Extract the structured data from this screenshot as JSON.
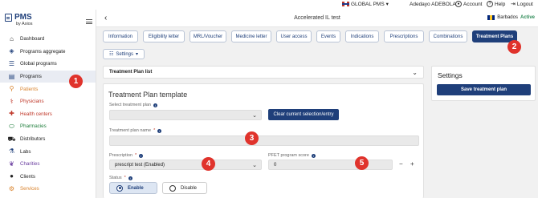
{
  "topbar": {
    "language": "GLOBAL PMS",
    "user": "Adedayo ADEBOLA",
    "account": "Account",
    "help": "Help",
    "logout": "Logout"
  },
  "logo": {
    "title": "PMS",
    "subtitle": "by Axios"
  },
  "sidebar": {
    "items": [
      {
        "label": "Dashboard",
        "icon": "home-icon",
        "glyph": "⌂"
      },
      {
        "label": "Programs aggregate",
        "icon": "layers-icon",
        "glyph": "◈"
      },
      {
        "label": "Global programs",
        "icon": "list-icon",
        "glyph": "☰"
      },
      {
        "label": "Programs",
        "icon": "clipboard-icon",
        "glyph": "▤"
      },
      {
        "label": "Patients",
        "icon": "person-icon",
        "glyph": "⚲"
      },
      {
        "label": "Physicians",
        "icon": "doctor-icon",
        "glyph": "⚕"
      },
      {
        "label": "Health centers",
        "icon": "hospital-icon",
        "glyph": "✚"
      },
      {
        "label": "Pharmacies",
        "icon": "pill-icon",
        "glyph": "⬭"
      },
      {
        "label": "Distributors",
        "icon": "truck-icon",
        "glyph": "⛟"
      },
      {
        "label": "Labs",
        "icon": "flask-icon",
        "glyph": "⚗"
      },
      {
        "label": "Charities",
        "icon": "charity-icon",
        "glyph": "❦"
      },
      {
        "label": "Clients",
        "icon": "client-icon",
        "glyph": "●"
      },
      {
        "label": "Services",
        "icon": "services-icon",
        "glyph": "⚙"
      }
    ]
  },
  "header": {
    "title": "Accelerated IL test",
    "country": "Barbados",
    "status": "Active"
  },
  "tabs": [
    {
      "label": "Information"
    },
    {
      "label": "Eligibility letter"
    },
    {
      "label": "MRL/Voucher"
    },
    {
      "label": "Medicine letter"
    },
    {
      "label": "User access"
    },
    {
      "label": "Events"
    },
    {
      "label": "Indications"
    },
    {
      "label": "Prescriptions"
    },
    {
      "label": "Combinations"
    },
    {
      "label": "Treatment Plans"
    }
  ],
  "settings_menu": {
    "label": "Settings"
  },
  "treatment_plan_list": {
    "label": "Treatment Plan list"
  },
  "template": {
    "title": "Treatment Plan template",
    "select_plan_label": "Select treatment plan",
    "select_plan_value": "",
    "clear_button": "Clear current selection/entry",
    "plan_name_label": "Treatment plan name",
    "plan_name_value": "",
    "prescription_label": "Prescription",
    "prescription_value": "prescript test (Enabled)",
    "pfet_label": "PFET program score",
    "pfet_value": "0",
    "status_label": "Status",
    "status_enable": "Enable",
    "status_disable": "Disable"
  },
  "side_panel": {
    "title": "Settings",
    "save_button": "Save treatment plan"
  },
  "markers": [
    "1",
    "2",
    "3",
    "4",
    "5"
  ],
  "colors": {
    "primary": "#1f3f7a",
    "marker": "#e0332c",
    "active_status": "#2e8b57",
    "sidebar_active": "#e9ecf3"
  }
}
